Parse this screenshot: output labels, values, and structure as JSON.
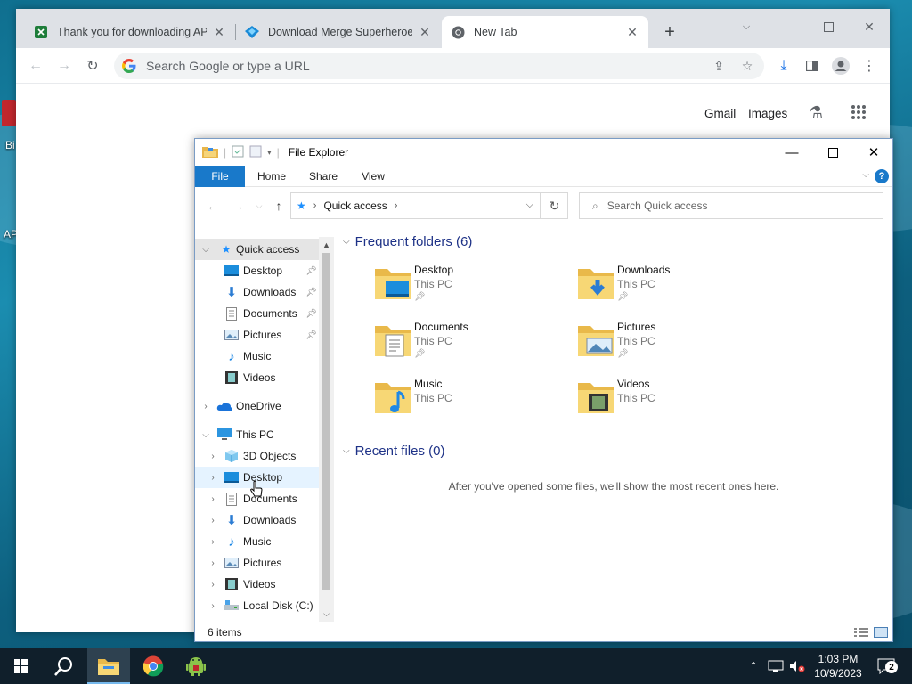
{
  "desktop": {
    "fragments": [
      "Bi",
      "AP"
    ]
  },
  "chrome": {
    "tabs": [
      {
        "title": "Thank you for downloading APK",
        "icon": "sheet-favicon"
      },
      {
        "title": "Download Merge Superheroes F",
        "icon": "diamond-favicon"
      },
      {
        "title": "New Tab",
        "icon": "chrome-favicon"
      }
    ],
    "omnibox_placeholder": "Search Google or type a URL",
    "ntp_links": {
      "gmail": "Gmail",
      "images": "Images"
    }
  },
  "explorer": {
    "title": "File Explorer",
    "ribbon_tabs": [
      "File",
      "Home",
      "Share",
      "View"
    ],
    "address": "Quick access",
    "search_placeholder": "Search Quick access",
    "nav": {
      "quick_access": "Quick access",
      "pinned": [
        "Desktop",
        "Downloads",
        "Documents",
        "Pictures"
      ],
      "unpinned": [
        "Music",
        "Videos"
      ],
      "onedrive": "OneDrive",
      "this_pc": "This PC",
      "pc_items": [
        "3D Objects",
        "Desktop",
        "Documents",
        "Downloads",
        "Music",
        "Pictures",
        "Videos",
        "Local Disk (C:)"
      ]
    },
    "frequent_header": "Frequent folders (6)",
    "folders": [
      {
        "name": "Desktop",
        "location": "This PC",
        "pinned": true
      },
      {
        "name": "Downloads",
        "location": "This PC",
        "pinned": true
      },
      {
        "name": "Documents",
        "location": "This PC",
        "pinned": true
      },
      {
        "name": "Pictures",
        "location": "This PC",
        "pinned": true
      },
      {
        "name": "Music",
        "location": "This PC",
        "pinned": false
      },
      {
        "name": "Videos",
        "location": "This PC",
        "pinned": false
      }
    ],
    "recent_header": "Recent files (0)",
    "recent_empty": "After you've opened some files, we'll show the most recent ones here.",
    "status": "6 items"
  },
  "taskbar": {
    "time": "1:03 PM",
    "date": "10/9/2023",
    "notifications": "2"
  }
}
